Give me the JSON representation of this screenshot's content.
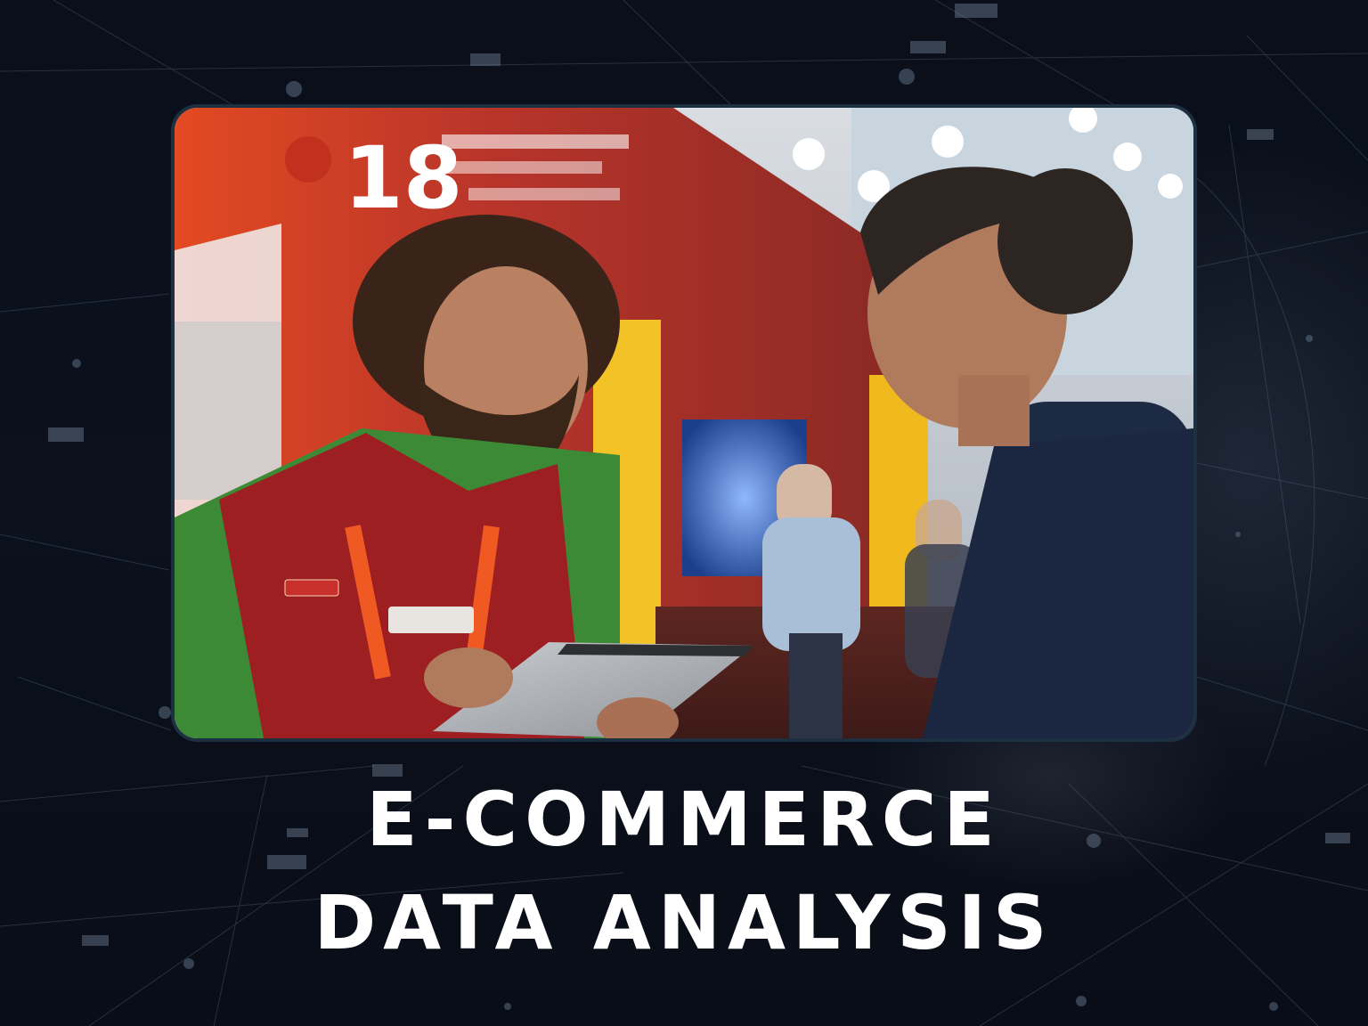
{
  "headline": {
    "line1": "E-COMMERCE",
    "line2": "DATA ANALYSIS"
  },
  "photo": {
    "subject": "trade-show-conversation-photo",
    "booth_number": "18"
  },
  "colors": {
    "background": "#0a0f1a",
    "frame_border": "#1d3042",
    "headline_text": "#ffffff",
    "network_lines": "#5a6f86"
  }
}
